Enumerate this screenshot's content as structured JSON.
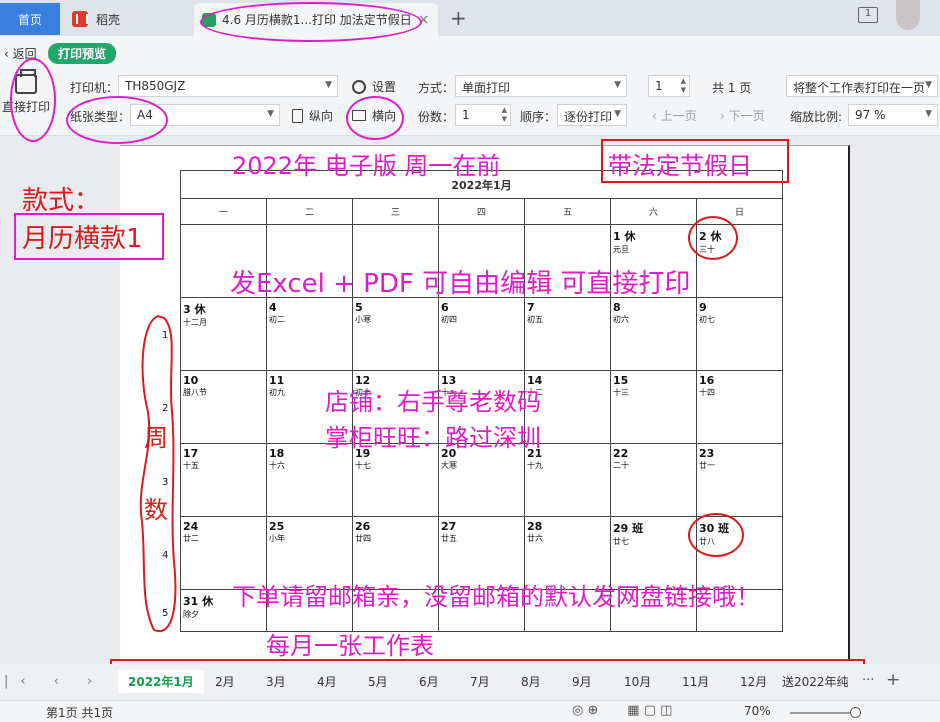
{
  "titlebar": {
    "home_tab": "首页",
    "shell_tab": "稻壳",
    "doc_tab": "4.6 月历横款1...打印 加法定节假日",
    "close_glyph": "×",
    "new_tab_glyph": "+",
    "win_badge": "1"
  },
  "toolbar": {
    "back": "返回",
    "preview_badge": "打印预览",
    "direct_print": "直接打印",
    "printer_label": "打印机：",
    "printer_value": "TH850GJZ",
    "settings": "设置",
    "paper_label": "纸张类型：",
    "paper_value": "A4",
    "portrait": "纵向",
    "landscape": "横向",
    "mode_label": "方式：",
    "mode_value": "单面打印",
    "copies_label": "份数：",
    "copies_value": "1",
    "order_label": "顺序：",
    "order_value": "逐份打印",
    "page_value": "1",
    "total_pages": "共 1 页",
    "prev_page": "上一页",
    "next_page": "下一页",
    "fit_value": "将整个工作表打印在一页",
    "scale_label": "缩放比例:",
    "scale_value": "97 %"
  },
  "calendar": {
    "title": "2022年1月",
    "weekdays": [
      "一",
      "二",
      "三",
      "四",
      "五",
      "六",
      "日"
    ],
    "weeks": [
      [
        {
          "d": "",
          "l": ""
        },
        {
          "d": "",
          "l": ""
        },
        {
          "d": "",
          "l": ""
        },
        {
          "d": "",
          "l": ""
        },
        {
          "d": "",
          "l": ""
        },
        {
          "d": "1 休",
          "l": "元旦"
        },
        {
          "d": "2 休",
          "l": "三十"
        }
      ],
      [
        {
          "d": "3 休",
          "l": "十二月"
        },
        {
          "d": "4",
          "l": "初二"
        },
        {
          "d": "5",
          "l": "小寒"
        },
        {
          "d": "6",
          "l": "初四"
        },
        {
          "d": "7",
          "l": "初五"
        },
        {
          "d": "8",
          "l": "初六"
        },
        {
          "d": "9",
          "l": "初七"
        }
      ],
      [
        {
          "d": "10",
          "l": "腊八节"
        },
        {
          "d": "11",
          "l": "初九"
        },
        {
          "d": "12",
          "l": "初十"
        },
        {
          "d": "13",
          "l": "十一"
        },
        {
          "d": "14",
          "l": "十二"
        },
        {
          "d": "15",
          "l": "十三"
        },
        {
          "d": "16",
          "l": "十四"
        }
      ],
      [
        {
          "d": "17",
          "l": "十五"
        },
        {
          "d": "18",
          "l": "十六"
        },
        {
          "d": "19",
          "l": "十七"
        },
        {
          "d": "20",
          "l": "大寒"
        },
        {
          "d": "21",
          "l": "十九"
        },
        {
          "d": "22",
          "l": "二十"
        },
        {
          "d": "23",
          "l": "廿一"
        }
      ],
      [
        {
          "d": "24",
          "l": "廿二"
        },
        {
          "d": "25",
          "l": "小年"
        },
        {
          "d": "26",
          "l": "廿四"
        },
        {
          "d": "27",
          "l": "廿五"
        },
        {
          "d": "28",
          "l": "廿六"
        },
        {
          "d": "29 班",
          "l": "廿七"
        },
        {
          "d": "30 班",
          "l": "廿八"
        }
      ],
      [
        {
          "d": "31 休",
          "l": "除夕"
        }
      ]
    ],
    "week_numbers": [
      "1",
      "2",
      "3",
      "4",
      "5"
    ]
  },
  "annotations": {
    "headline": "2022年  电子版  周一在前",
    "holiday_box": "带法定节假日",
    "style_label": "款式：",
    "style_value": "月历横款1",
    "formats": "发Excel + PDF 可自由编辑 可直接打印",
    "shop": "店铺：右手尊老数码",
    "owner": "掌柜旺旺：路过深圳",
    "week_label_1": "周",
    "week_label_2": "数",
    "order_note": "下单请留邮箱亲，没留邮箱的默认发网盘链接哦！",
    "per_month": "每月一张工作表"
  },
  "sheets": {
    "tabs": [
      "2022年1月",
      "2月",
      "3月",
      "4月",
      "5月",
      "6月",
      "7月",
      "8月",
      "9月",
      "10月",
      "11月",
      "12月",
      "送2022年纯"
    ],
    "more": "···",
    "add": "+"
  },
  "status": {
    "page_info": "第1页 共1页",
    "zoom": "70%"
  },
  "colors": {
    "annotation_magenta": "#e01cc9",
    "annotation_red": "#d81c1c",
    "active_sheet": "#1a9a4a",
    "preview_badge": "#20a86a",
    "home_tab": "#3a7fe0"
  }
}
